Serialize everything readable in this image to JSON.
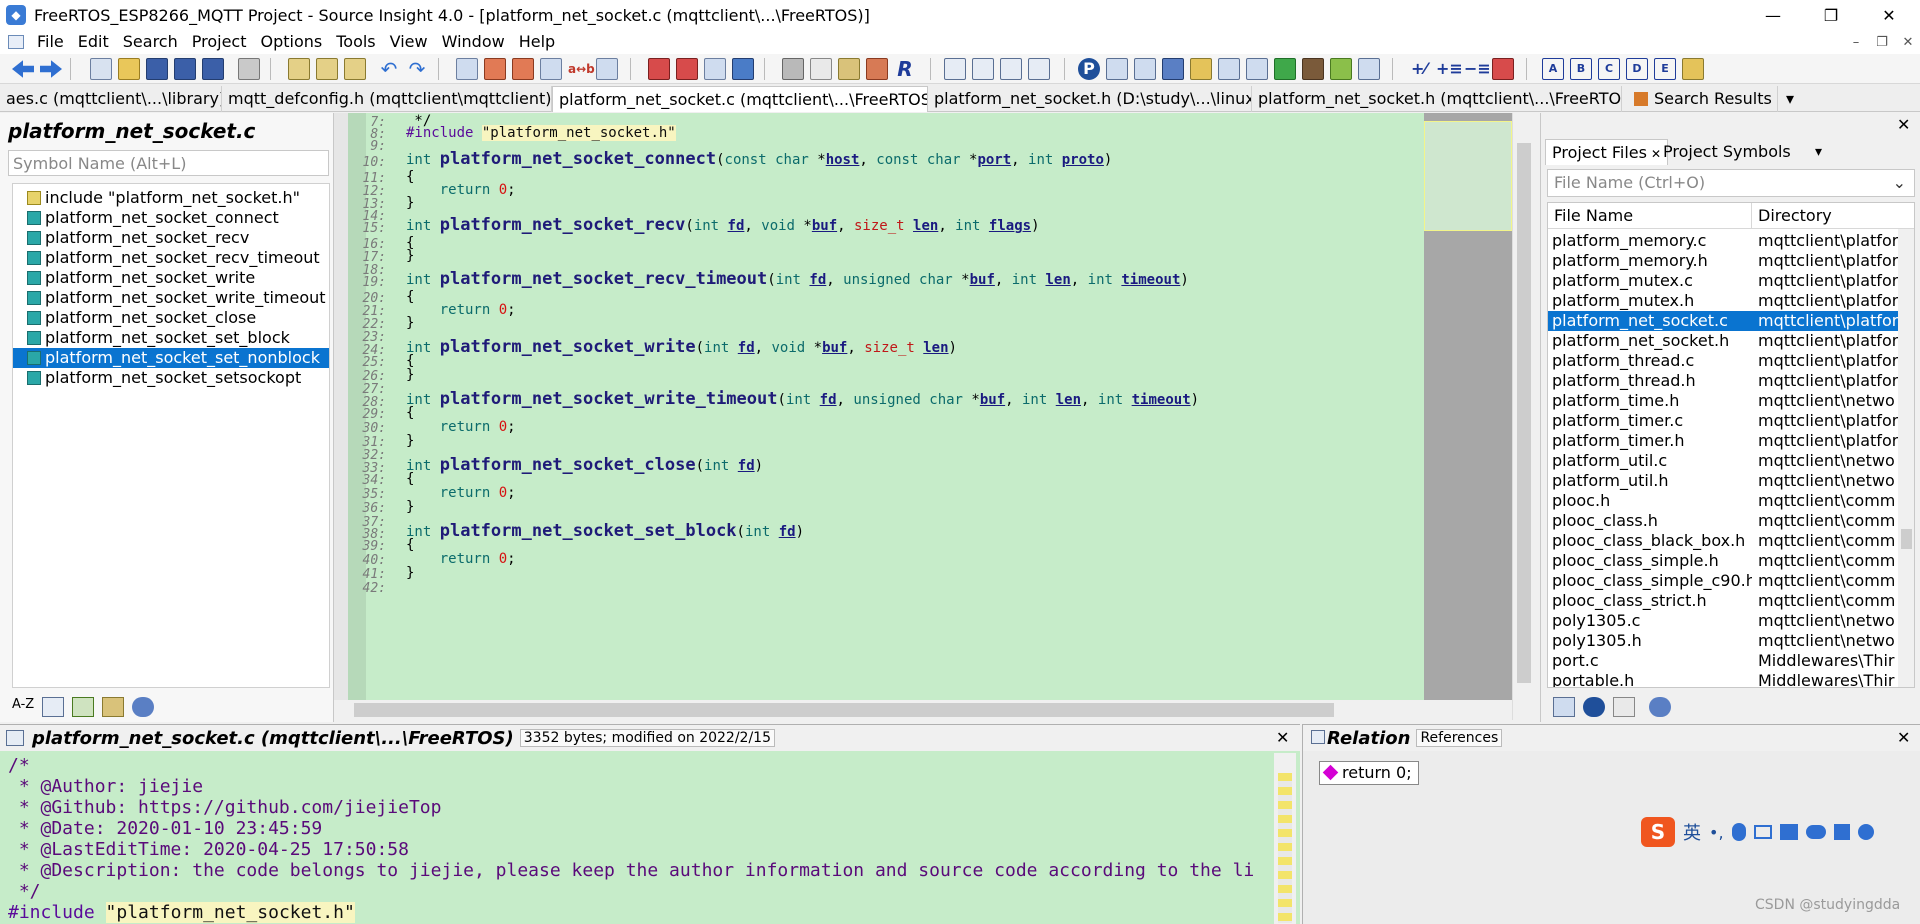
{
  "window": {
    "title": "FreeRTOS_ESP8266_MQTT Project - Source Insight 4.0 - [platform_net_socket.c (mqttclient\\...\\FreeRTOS)]",
    "minimize": "—",
    "maximize": "❐",
    "close": "✕"
  },
  "menu": [
    "File",
    "Edit",
    "Search",
    "Project",
    "Options",
    "Tools",
    "View",
    "Window",
    "Help"
  ],
  "mdi": {
    "minimize": "–",
    "restore": "❐",
    "close": "✕"
  },
  "tabs": [
    {
      "label": "aes.c (mqttclient\\...\\library)"
    },
    {
      "label": "mqtt_defconfig.h (mqttclient\\mqttclient)"
    },
    {
      "label": "platform_net_socket.c (mqttclient\\...\\FreeRTOS)",
      "close": "✕"
    },
    {
      "label": "platform_net_socket.h (D:\\study\\...\\linux)"
    },
    {
      "label": "platform_net_socket.h (mqttclient\\...\\FreeRTOS)"
    },
    {
      "label": "Search Results"
    }
  ],
  "tab_overflow": "▾",
  "symbols": {
    "title": "platform_net_socket.c",
    "search_placeholder": "Symbol Name (Alt+L)",
    "items": [
      "include \"platform_net_socket.h\"",
      "platform_net_socket_connect",
      "platform_net_socket_recv",
      "platform_net_socket_recv_timeout",
      "platform_net_socket_write",
      "platform_net_socket_write_timeout",
      "platform_net_socket_close",
      "platform_net_socket_set_block",
      "platform_net_socket_set_nonblock",
      "platform_net_socket_setsockopt"
    ],
    "selected_index": 8,
    "footer_sort": "A-Z"
  },
  "editor": {
    "lines": [
      {
        "n": "7:",
        "text": " */"
      },
      {
        "n": "8:",
        "text": "#include \"platform_net_socket.h\""
      },
      {
        "n": "9:",
        "text": ""
      },
      {
        "n": "10:",
        "text": "int platform_net_socket_connect(const char *host, const char *port, int proto)"
      },
      {
        "n": "11:",
        "text": "{"
      },
      {
        "n": "12:",
        "text": "    return 0;"
      },
      {
        "n": "13:",
        "text": "}"
      },
      {
        "n": "14:",
        "text": ""
      },
      {
        "n": "15:",
        "text": "int platform_net_socket_recv(int fd, void *buf, size_t len, int flags)"
      },
      {
        "n": "16:",
        "text": "{"
      },
      {
        "n": "17:",
        "text": "}"
      },
      {
        "n": "18:",
        "text": ""
      },
      {
        "n": "19:",
        "text": "int platform_net_socket_recv_timeout(int fd, unsigned char *buf, int len, int timeout)"
      },
      {
        "n": "20:",
        "text": "{"
      },
      {
        "n": "21:",
        "text": "    return 0;"
      },
      {
        "n": "22:",
        "text": "}"
      },
      {
        "n": "23:",
        "text": ""
      },
      {
        "n": "24:",
        "text": "int platform_net_socket_write(int fd, void *buf, size_t len)"
      },
      {
        "n": "25:",
        "text": "{"
      },
      {
        "n": "26:",
        "text": "}"
      },
      {
        "n": "27:",
        "text": ""
      },
      {
        "n": "28:",
        "text": "int platform_net_socket_write_timeout(int fd, unsigned char *buf, int len, int timeout)"
      },
      {
        "n": "29:",
        "text": "{"
      },
      {
        "n": "30:",
        "text": "    return 0;"
      },
      {
        "n": "31:",
        "text": "}"
      },
      {
        "n": "32:",
        "text": ""
      },
      {
        "n": "33:",
        "text": "int platform_net_socket_close(int fd)"
      },
      {
        "n": "34:",
        "text": "{"
      },
      {
        "n": "35:",
        "text": "    return 0;"
      },
      {
        "n": "36:",
        "text": "}"
      },
      {
        "n": "37:",
        "text": ""
      },
      {
        "n": "38:",
        "text": "int platform_net_socket_set_block(int fd)"
      },
      {
        "n": "39:",
        "text": "{"
      },
      {
        "n": "40:",
        "text": "    return 0;"
      },
      {
        "n": "41:",
        "text": "}"
      },
      {
        "n": "42:",
        "text": ""
      }
    ]
  },
  "project": {
    "tabs": [
      "Project Files",
      "Project Symbols"
    ],
    "tab_close": "✕",
    "file_placeholder": "File Name (Ctrl+O)",
    "columns": [
      "File Name",
      "Directory"
    ],
    "files": [
      {
        "name": "platform_memory.c",
        "dir": "mqttclient\\platfor"
      },
      {
        "name": "platform_memory.h",
        "dir": "mqttclient\\platfor"
      },
      {
        "name": "platform_mutex.c",
        "dir": "mqttclient\\platfor"
      },
      {
        "name": "platform_mutex.h",
        "dir": "mqttclient\\platfor"
      },
      {
        "name": "platform_net_socket.c",
        "dir": "mqttclient\\platfor"
      },
      {
        "name": "platform_net_socket.h",
        "dir": "mqttclient\\platfor"
      },
      {
        "name": "platform_thread.c",
        "dir": "mqttclient\\platfor"
      },
      {
        "name": "platform_thread.h",
        "dir": "mqttclient\\platfor"
      },
      {
        "name": "platform_time.h",
        "dir": "mqttclient\\netwo"
      },
      {
        "name": "platform_timer.c",
        "dir": "mqttclient\\platfor"
      },
      {
        "name": "platform_timer.h",
        "dir": "mqttclient\\platfor"
      },
      {
        "name": "platform_util.c",
        "dir": "mqttclient\\netwo"
      },
      {
        "name": "platform_util.h",
        "dir": "mqttclient\\netwo"
      },
      {
        "name": "plooc.h",
        "dir": "mqttclient\\comm"
      },
      {
        "name": "plooc_class.h",
        "dir": "mqttclient\\comm"
      },
      {
        "name": "plooc_class_black_box.h",
        "dir": "mqttclient\\comm"
      },
      {
        "name": "plooc_class_simple.h",
        "dir": "mqttclient\\comm"
      },
      {
        "name": "plooc_class_simple_c90.h",
        "dir": "mqttclient\\comm"
      },
      {
        "name": "plooc_class_strict.h",
        "dir": "mqttclient\\comm"
      },
      {
        "name": "poly1305.c",
        "dir": "mqttclient\\netwo"
      },
      {
        "name": "poly1305.h",
        "dir": "mqttclient\\netwo"
      },
      {
        "name": "port.c",
        "dir": "Middlewares\\Thir"
      },
      {
        "name": "portable.h",
        "dir": "Middlewares\\Thir"
      }
    ],
    "selected_index": 4
  },
  "context": {
    "title": "platform_net_socket.c (mqttclient\\...\\FreeRTOS)",
    "info": "3352 bytes; modified on 2022/2/15",
    "close": "✕",
    "lines": [
      "/*",
      " * @Author: jiejie",
      " * @Github: https://github.com/jiejieTop",
      " * @Date: 2020-01-10 23:45:59",
      " * @LastEditTime: 2020-04-25 17:50:58",
      " * @Description: the code belongs to jiejie, please keep the author information and source code according to the li",
      " */",
      "#include \"platform_net_socket.h\""
    ]
  },
  "relation": {
    "title": "Relation",
    "button": "References",
    "close": "✕",
    "node": "return 0;",
    "ime_lang": "英"
  },
  "watermark": "CSDN @studyingdda"
}
